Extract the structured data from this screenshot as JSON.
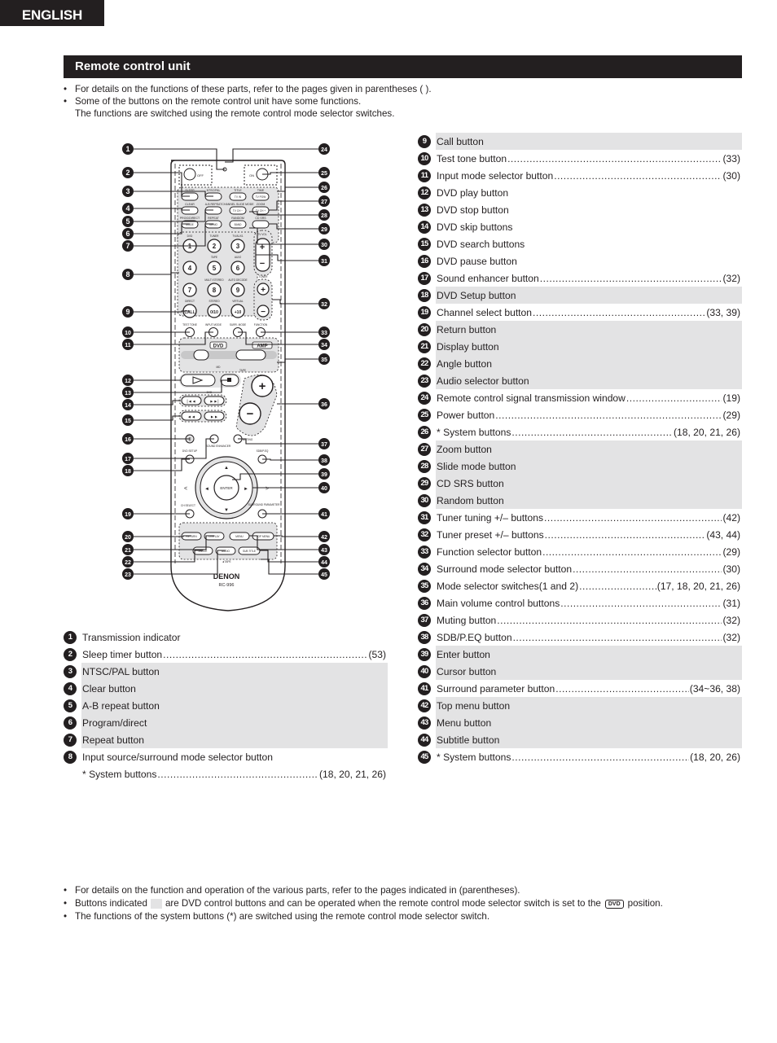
{
  "language_tab": "ENGLISH",
  "section_title": "Remote control unit",
  "intro": {
    "bullets": [
      "For details on the functions of these parts, refer to the pages given in parentheses ( ).",
      "Some of the buttons on the remote control unit have some functions."
    ],
    "continuation": "The functions are switched using the remote control mode selector switches."
  },
  "bullet_char": "•",
  "colors": {
    "dark": "#231f20",
    "dvd_shade": "#e3e3e4"
  },
  "remote": {
    "brand": "DENON",
    "model": "RC-996",
    "labels": {
      "off": "OFF",
      "on": "ON",
      "sleep": "SLEEP",
      "ntsc": "NTSC/PAL",
      "multi_mode": "MULTI MODE",
      "title": "TITLE",
      "time": "TIME",
      "tv_in": "TV IN",
      "tv_pow": "TV POW",
      "ntsc_btn": "INT. O PIOW",
      "clear": "CLEAR",
      "ab_repeat": "A-B REPEAT",
      "show": "SHOW",
      "chan_slide": "CHANNEL SLIDE MODE",
      "sur_zoom": "ZOOM",
      "tvch_minus": "TV CH −",
      "tvch_plus": "TV CH +",
      "prog_direct": "PROG/DIRECT",
      "repeat": "REPEAT",
      "random": "RANDOM",
      "cd_srs": "CD SRS",
      "mode": "MODE",
      "memo": "MEMO",
      "band": "BAND",
      "dvd": "DVD",
      "tuner": "TUNER",
      "tv_aux": "TV/AUX1",
      "tape": "TAPE",
      "aux2": "AUX2",
      "multi_stereo": "MULTI STEREO",
      "auto_decode": "AUTO DECODE",
      "direct": "DIRECT",
      "stereo": "STEREO",
      "virtual": "VIRTUAL",
      "tv_vol": "TV VOL",
      "tuner_pre": "TUNER",
      "test_tone": "TEST TONE",
      "input_mode": "INPUT MODE",
      "surr_mode": "SURR. MODE",
      "function": "FUNCTION",
      "amp": "AMP",
      "md": "MD",
      "tape2": "TAPE",
      "tv_vcr": "TV/VCR",
      "dvd_small": "DVD",
      "muting": "MUTING",
      "sound_enh": "SOUND ENHANCER",
      "dvd_setup": "DVD SETUP",
      "sdb": "SDB/P.EQ",
      "enter": "ENTER",
      "ch_select": "CH SELECT",
      "surr_param": "SURROUND PARAMETER",
      "return": "RETURN",
      "display": "DISPLAY",
      "menu": "MENU",
      "top_menu": "TOP MENU",
      "angle": "ANGLE",
      "audio": "AUDIO",
      "subtitle": "SUB TITLE",
      "cdr": "CD-R",
      "tape_bottom": "◄TAPE",
      "call": "CALL"
    },
    "number_keys": [
      "1",
      "2",
      "3",
      "4",
      "5",
      "6",
      "7",
      "8",
      "9",
      "CALL",
      "0/10",
      "+10"
    ]
  },
  "left_list": [
    {
      "n": "1",
      "label": "Transmission indicator",
      "pages": "",
      "dvd": false
    },
    {
      "n": "2",
      "label": "Sleep timer button",
      "pages": "(53)",
      "dvd": false
    },
    {
      "n": "3",
      "label": "NTSC/PAL button",
      "pages": "",
      "dvd": true
    },
    {
      "n": "4",
      "label": "Clear button",
      "pages": "",
      "dvd": true
    },
    {
      "n": "5",
      "label": "A-B repeat button",
      "pages": "",
      "dvd": true
    },
    {
      "n": "6",
      "label": "Program/direct",
      "pages": "",
      "dvd": true
    },
    {
      "n": "7",
      "label": "Repeat button",
      "pages": "",
      "dvd": true
    },
    {
      "n": "8",
      "label": "Input source/surround mode selector button",
      "pages": "",
      "dvd": false
    },
    {
      "n": "",
      "label": "* System buttons",
      "pages": "(18, 20, 21, 26)",
      "dvd": false
    }
  ],
  "right_list": [
    {
      "n": "9",
      "label": "Call button",
      "pages": "",
      "dvd": true
    },
    {
      "n": "10",
      "label": "Test tone button",
      "pages": "(33)",
      "dvd": false
    },
    {
      "n": "11",
      "label": "Input mode selector button",
      "pages": "(30)",
      "dvd": false
    },
    {
      "n": "12",
      "label": "DVD play button",
      "pages": "",
      "dvd": false
    },
    {
      "n": "13",
      "label": "DVD stop button",
      "pages": "",
      "dvd": false
    },
    {
      "n": "14",
      "label": "DVD skip buttons",
      "pages": "",
      "dvd": false
    },
    {
      "n": "15",
      "label": "DVD search buttons",
      "pages": "",
      "dvd": false
    },
    {
      "n": "16",
      "label": "DVD pause button",
      "pages": "",
      "dvd": false
    },
    {
      "n": "17",
      "label": "Sound enhancer button",
      "pages": "(32)",
      "dvd": false
    },
    {
      "n": "18",
      "label": "DVD Setup button",
      "pages": "",
      "dvd": true
    },
    {
      "n": "19",
      "label": "Channel select button",
      "pages": "(33, 39)",
      "dvd": false
    },
    {
      "n": "20",
      "label": "Return button",
      "pages": "",
      "dvd": true
    },
    {
      "n": "21",
      "label": "Display button",
      "pages": "",
      "dvd": true
    },
    {
      "n": "22",
      "label": "Angle button",
      "pages": "",
      "dvd": true
    },
    {
      "n": "23",
      "label": "Audio selector button",
      "pages": "",
      "dvd": true
    },
    {
      "n": "24",
      "label": "Remote control signal transmission window",
      "pages": "(19)",
      "dvd": false
    },
    {
      "n": "25",
      "label": "Power button",
      "pages": "(29)",
      "dvd": false
    },
    {
      "n": "26",
      "label": "* System buttons",
      "pages": "(18, 20, 21, 26)",
      "dvd": false
    },
    {
      "n": "27",
      "label": "Zoom button",
      "pages": "",
      "dvd": true
    },
    {
      "n": "28",
      "label": "Slide mode button",
      "pages": "",
      "dvd": true
    },
    {
      "n": "29",
      "label": "CD SRS button",
      "pages": "",
      "dvd": true
    },
    {
      "n": "30",
      "label": "Random button",
      "pages": "",
      "dvd": true
    },
    {
      "n": "31",
      "label": "Tuner tuning +/– buttons",
      "pages": "(42)",
      "dvd": false
    },
    {
      "n": "32",
      "label": "Tuner preset +/– buttons",
      "pages": "(43, 44)",
      "dvd": false
    },
    {
      "n": "33",
      "label": "Function selector button",
      "pages": "(29)",
      "dvd": false
    },
    {
      "n": "34",
      "label": "Surround mode selector button",
      "pages": "(30)",
      "dvd": false
    },
    {
      "n": "35",
      "label": "Mode selector switches(1 and 2)",
      "pages": "(17, 18, 20, 21, 26)",
      "dvd": false
    },
    {
      "n": "36",
      "label": "Main volume control buttons",
      "pages": "(31)",
      "dvd": false
    },
    {
      "n": "37",
      "label": "Muting button",
      "pages": "(32)",
      "dvd": false
    },
    {
      "n": "38",
      "label": "SDB/P.EQ button",
      "pages": "(32)",
      "dvd": false
    },
    {
      "n": "39",
      "label": "Enter button",
      "pages": "",
      "dvd": true
    },
    {
      "n": "40",
      "label": "Cursor button",
      "pages": "",
      "dvd": true
    },
    {
      "n": "41",
      "label": "Surround parameter button",
      "pages": "(34~36, 38)",
      "dvd": false
    },
    {
      "n": "42",
      "label": "Top menu button",
      "pages": "",
      "dvd": true
    },
    {
      "n": "43",
      "label": "Menu button",
      "pages": "",
      "dvd": true
    },
    {
      "n": "44",
      "label": "Subtitle button",
      "pages": "",
      "dvd": true
    },
    {
      "n": "45",
      "label": "* System buttons",
      "pages": "(18, 20, 26)",
      "dvd": false
    }
  ],
  "notes": {
    "line1": "For details on the function and operation of the various parts, refer to the pages indicated in (parentheses).",
    "line2_a": "Buttons indicated",
    "line2_b": "are DVD control buttons and can be operated when the remote control mode selector switch is set to the",
    "line2_badge": "DVD",
    "line2_c": "position.",
    "line3": "The functions of the system buttons (*) are switched using the remote control mode selector switch."
  },
  "callouts_left": [
    "1",
    "2",
    "3",
    "4",
    "5",
    "6",
    "7",
    "8",
    "9",
    "10",
    "11",
    "12",
    "13",
    "14",
    "15",
    "16",
    "17",
    "18",
    "19",
    "20",
    "21",
    "22",
    "23"
  ],
  "callouts_right": [
    "24",
    "25",
    "26",
    "27",
    "28",
    "29",
    "30",
    "31",
    "32",
    "33",
    "34",
    "35",
    "36",
    "37",
    "38",
    "39",
    "40",
    "41",
    "42",
    "43",
    "44",
    "45"
  ]
}
